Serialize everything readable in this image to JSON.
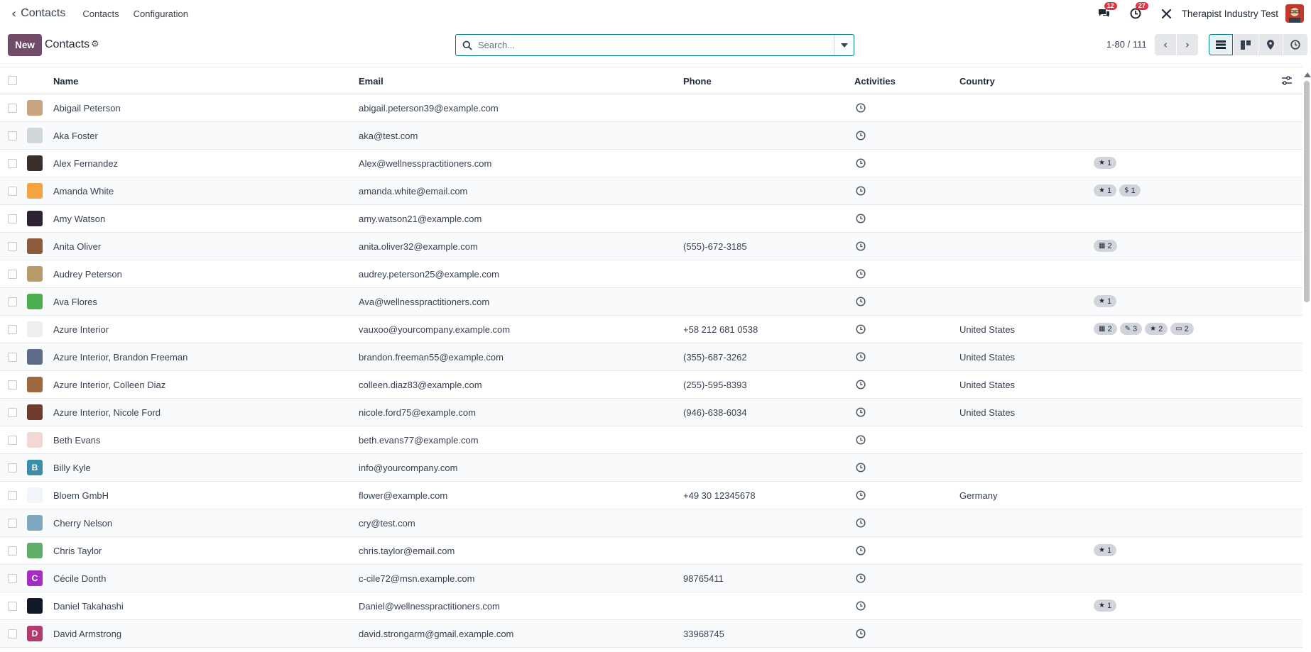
{
  "navbar": {
    "app_name": "Contacts",
    "menus": [
      "Contacts",
      "Configuration"
    ],
    "messages_count": "12",
    "activities_count": "27",
    "company": "Therapist Industry Test"
  },
  "control_panel": {
    "new_label": "New",
    "title": "Contacts",
    "search_placeholder": "Search...",
    "pager": "1-80 / 111"
  },
  "table": {
    "headers": {
      "name": "Name",
      "email": "Email",
      "phone": "Phone",
      "activities": "Activities",
      "country": "Country"
    },
    "rows": [
      {
        "name": "Abigail Peterson",
        "email": "abigail.peterson39@example.com",
        "phone": "",
        "country": "",
        "avatar_color": "#c9a27e",
        "initial": "",
        "tags": []
      },
      {
        "name": "Aka Foster",
        "email": "aka@test.com",
        "phone": "",
        "country": "",
        "avatar_color": "#cfd8dc",
        "initial": "",
        "tags": []
      },
      {
        "name": "Alex Fernandez",
        "email": "Alex@wellnesspractitioners.com",
        "phone": "",
        "country": "",
        "avatar_color": "#3a2f2a",
        "initial": "",
        "tags": [
          {
            "icon": "★",
            "value": "1"
          }
        ]
      },
      {
        "name": "Amanda White",
        "email": "amanda.white@email.com",
        "phone": "",
        "country": "",
        "avatar_color": "#f4a340",
        "initial": "",
        "tags": [
          {
            "icon": "★",
            "value": "1"
          },
          {
            "icon": "$",
            "value": "1"
          }
        ]
      },
      {
        "name": "Amy Watson",
        "email": "amy.watson21@example.com",
        "phone": "",
        "country": "",
        "avatar_color": "#2d2233",
        "initial": "",
        "tags": []
      },
      {
        "name": "Anita Oliver",
        "email": "anita.oliver32@example.com",
        "phone": "(555)-672-3185",
        "country": "",
        "avatar_color": "#8d5a3b",
        "initial": "",
        "tags": [
          {
            "icon": "▦",
            "value": "2"
          }
        ]
      },
      {
        "name": "Audrey Peterson",
        "email": "audrey.peterson25@example.com",
        "phone": "",
        "country": "",
        "avatar_color": "#b89a6a",
        "initial": "",
        "tags": []
      },
      {
        "name": "Ava Flores",
        "email": "Ava@wellnesspractitioners.com",
        "phone": "",
        "country": "",
        "avatar_color": "#4caf50",
        "initial": "",
        "tags": [
          {
            "icon": "★",
            "value": "1"
          }
        ]
      },
      {
        "name": "Azure Interior",
        "email": "vauxoo@yourcompany.example.com",
        "phone": "+58 212 681 0538",
        "country": "United States",
        "avatar_color": "#eceff1",
        "initial": "",
        "tags": [
          {
            "icon": "▦",
            "value": "2"
          },
          {
            "icon": "✎",
            "value": "3"
          },
          {
            "icon": "★",
            "value": "2"
          },
          {
            "icon": "▭",
            "value": "2"
          }
        ]
      },
      {
        "name": "Azure Interior, Brandon Freeman",
        "email": "brandon.freeman55@example.com",
        "phone": "(355)-687-3262",
        "country": "United States",
        "avatar_color": "#5c6b8a",
        "initial": "",
        "tags": []
      },
      {
        "name": "Azure Interior, Colleen Diaz",
        "email": "colleen.diaz83@example.com",
        "phone": "(255)-595-8393",
        "country": "United States",
        "avatar_color": "#a0683e",
        "initial": "",
        "tags": []
      },
      {
        "name": "Azure Interior, Nicole Ford",
        "email": "nicole.ford75@example.com",
        "phone": "(946)-638-6034",
        "country": "United States",
        "avatar_color": "#6d3b2e",
        "initial": "",
        "tags": []
      },
      {
        "name": "Beth Evans",
        "email": "beth.evans77@example.com",
        "phone": "",
        "country": "",
        "avatar_color": "#f2d7d5",
        "initial": "",
        "tags": []
      },
      {
        "name": "Billy Kyle",
        "email": "info@yourcompany.com",
        "phone": "",
        "country": "",
        "avatar_color": "#3c8ea5",
        "initial": "B",
        "tags": []
      },
      {
        "name": "Bloem GmbH",
        "email": "flower@example.com",
        "phone": "+49 30 12345678",
        "country": "Germany",
        "avatar_color": "#f1f5f9",
        "initial": "",
        "tags": []
      },
      {
        "name": "Cherry Nelson",
        "email": "cry@test.com",
        "phone": "",
        "country": "",
        "avatar_color": "#7fa7c0",
        "initial": "",
        "tags": []
      },
      {
        "name": "Chris Taylor",
        "email": "chris.taylor@email.com",
        "phone": "",
        "country": "",
        "avatar_color": "#5fae6b",
        "initial": "",
        "tags": [
          {
            "icon": "★",
            "value": "1"
          }
        ]
      },
      {
        "name": "Cécile Donth",
        "email": "c-cile72@msn.example.com",
        "phone": "98765411",
        "country": "",
        "avatar_color": "#a42ec1",
        "initial": "C",
        "tags": []
      },
      {
        "name": "Daniel Takahashi",
        "email": "Daniel@wellnesspractitioners.com",
        "phone": "",
        "country": "",
        "avatar_color": "#111827",
        "initial": "",
        "tags": [
          {
            "icon": "★",
            "value": "1"
          }
        ]
      },
      {
        "name": "David Armstrong",
        "email": "david.strongarm@gmail.example.com",
        "phone": "33968745",
        "country": "",
        "avatar_color": "#b33a6f",
        "initial": "D",
        "tags": []
      }
    ]
  }
}
